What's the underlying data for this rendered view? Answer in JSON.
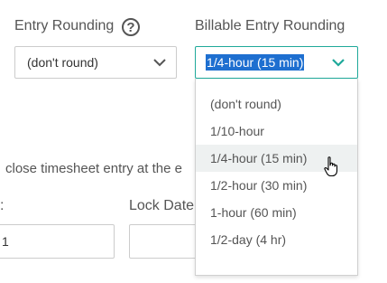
{
  "entry_rounding": {
    "label": "Entry Rounding",
    "help_icon_glyph": "?",
    "value": "(don't round)"
  },
  "billable_rounding": {
    "label": "Billable Entry Rounding",
    "value": "1/4-hour (15 min)",
    "accent_color": "#1fa99a",
    "options": [
      "(don't round)",
      "1/10-hour",
      "1/4-hour (15 min)",
      "1/2-hour (30 min)",
      "1-hour (60 min)",
      "1/2-day (4 hr)"
    ]
  },
  "auto_close_text": "close timesheet entry at the e",
  "left_field": {
    "label": ":",
    "value": "1"
  },
  "lock_date": {
    "label": "Lock Date"
  }
}
